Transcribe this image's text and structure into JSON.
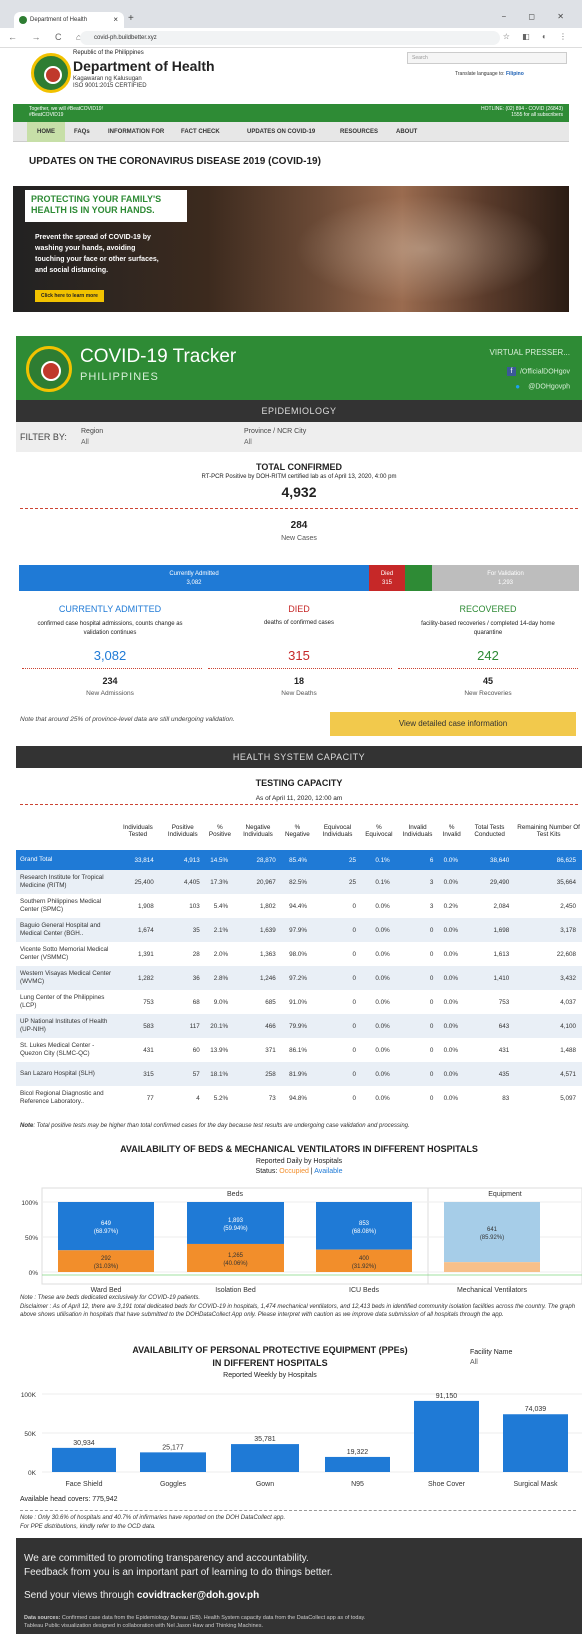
{
  "browser": {
    "tab_title": "Department of Health",
    "url": "covid-ph.buildbetter.xyz",
    "new_tab": "+",
    "controls": "−  ◻  ✕",
    "nav": "← → C ⌂",
    "icons": "☆ ◧ ◐ ⋮"
  },
  "doh": {
    "republic": "Republic of the Philippines",
    "department": "Department of Health",
    "kagawaran": "Kagawaran ng Kalusugan",
    "iso": "ISO 9001:2015 CERTIFIED",
    "search_placeholder": "Search",
    "translate_label": "Translate language to:",
    "translate_lang": "Filipino",
    "greenbar_left": [
      "Together, we will #BeatCOVID19!",
      "#BeatCOVID19"
    ],
    "greenbar_right": [
      "HOTLINE: (02) 894 - COVID (26843)",
      "1555 for all subscribers"
    ],
    "menu": [
      "HOME",
      "FAQs",
      "INFORMATION FOR",
      "FACT CHECK",
      "UPDATES ON COVID-19",
      "RESOURCES",
      "ABOUT"
    ],
    "page_title": "UPDATES ON THE CORONAVIRUS DISEASE 2019 (COVID-19)",
    "hero_headline": "PROTECTING YOUR FAMILY'S HEALTH IS IN YOUR HANDS.",
    "hero_desc": "Prevent the spread of COVID-19 by washing your hands, avoiding touching your face or other surfaces, and social distancing.",
    "hero_button": "Click here to learn more"
  },
  "tracker": {
    "title": "COVID-19 Tracker",
    "country": "PHILIPPINES",
    "virtual": "VIRTUAL PRESSER...",
    "facebook": "/OfficialDOHgov",
    "twitter": "@DOHgovph"
  },
  "epi": {
    "section": "EPIDEMIOLOGY",
    "filter_by": "FILTER BY:",
    "region_label": "Region",
    "region_value": "All",
    "province_label": "Province / NCR City",
    "province_value": "All",
    "total_title": "TOTAL CONFIRMED",
    "total_sub": "RT-PCR Positive by DOH-RITM certified lab as of April 13, 2020, 4:00 pm",
    "total": "4,932",
    "new_cases": "284",
    "new_cases_label": "New Cases",
    "bar": {
      "admitted_label": "Currently Admitted",
      "admitted": "3,082",
      "died_label": "Died",
      "died": "315",
      "validation_label": "For Validation",
      "validation": "1,293"
    },
    "admitted_title": "CURRENTLY ADMITTED",
    "admitted_desc": "confirmed case hospital admissions, counts change as validation continues",
    "admitted_value": "3,082",
    "new_admissions": "234",
    "new_admissions_label": "New Admissions",
    "died_title": "DIED",
    "died_desc": "deaths of confirmed cases",
    "died_value": "315",
    "new_deaths": "18",
    "new_deaths_label": "New Deaths",
    "recovered_title": "RECOVERED",
    "recovered_desc": "facility-based recoveries / completed 14-day home quarantine",
    "recovered_value": "242",
    "new_recoveries": "45",
    "new_recoveries_label": "New Recoveries",
    "note": "Note that around 25% of province-level data are still undergoing validation.",
    "detail_button": "View detailed case information"
  },
  "hsc": {
    "section": "HEALTH SYSTEM CAPACITY",
    "testing_title": "TESTING CAPACITY",
    "testing_sub": "As of April 11, 2020, 12:00 am",
    "headers": [
      "",
      "Individuals Tested",
      "Positive Individuals",
      "% Positive",
      "Negative Individuals",
      "% Negative",
      "Equivocal Individuals",
      "% Equivocal",
      "Invalid Individuals",
      "% Invalid",
      "Total Tests Conducted",
      "Remaining Number Of Test Kits"
    ],
    "rows": [
      [
        "Grand Total",
        "33,814",
        "4,913",
        "14.5%",
        "28,870",
        "85.4%",
        "25",
        "0.1%",
        "6",
        "0.0%",
        "38,640",
        "86,625"
      ],
      [
        "Research Institute for Tropical Medicine (RITM)",
        "25,400",
        "4,405",
        "17.3%",
        "20,967",
        "82.5%",
        "25",
        "0.1%",
        "3",
        "0.0%",
        "29,490",
        "35,664"
      ],
      [
        "Southern Philippines Medical Center (SPMC)",
        "1,908",
        "103",
        "5.4%",
        "1,802",
        "94.4%",
        "0",
        "0.0%",
        "3",
        "0.2%",
        "2,084",
        "2,450"
      ],
      [
        "Baguio General Hospital and Medical Center (BGH..",
        "1,674",
        "35",
        "2.1%",
        "1,639",
        "97.9%",
        "0",
        "0.0%",
        "0",
        "0.0%",
        "1,698",
        "3,178"
      ],
      [
        "Vicente Sotto Memorial Medical Center (VSMMC)",
        "1,391",
        "28",
        "2.0%",
        "1,363",
        "98.0%",
        "0",
        "0.0%",
        "0",
        "0.0%",
        "1,613",
        "22,608"
      ],
      [
        "Western Visayas Medical Center (WVMC)",
        "1,282",
        "36",
        "2.8%",
        "1,246",
        "97.2%",
        "0",
        "0.0%",
        "0",
        "0.0%",
        "1,410",
        "3,432"
      ],
      [
        "Lung Center of the Philippines (LCP)",
        "753",
        "68",
        "9.0%",
        "685",
        "91.0%",
        "0",
        "0.0%",
        "0",
        "0.0%",
        "753",
        "4,037"
      ],
      [
        "UP National Institutes of Health (UP-NIH)",
        "583",
        "117",
        "20.1%",
        "466",
        "79.9%",
        "0",
        "0.0%",
        "0",
        "0.0%",
        "643",
        "4,100"
      ],
      [
        "St. Lukes Medical Center - Quezon City (SLMC-QC)",
        "431",
        "60",
        "13.9%",
        "371",
        "86.1%",
        "0",
        "0.0%",
        "0",
        "0.0%",
        "431",
        "1,488"
      ],
      [
        "San Lazaro Hospital (SLH)",
        "315",
        "57",
        "18.1%",
        "258",
        "81.9%",
        "0",
        "0.0%",
        "0",
        "0.0%",
        "435",
        "4,571"
      ],
      [
        "Bicol Regional Diagnostic and Reference Laboratory..",
        "77",
        "4",
        "5.2%",
        "73",
        "94.8%",
        "0",
        "0.0%",
        "0",
        "0.0%",
        "83",
        "5,097"
      ]
    ],
    "table_note_bold": "Note",
    "table_note": ": Total positive tests may be higher than total confirmed cases for the day because test results are undergoing case validation and processing.",
    "beds_title": "AVAILABILITY OF BEDS & MECHANICAL VENTILATORS IN DIFFERENT HOSPITALS",
    "beds_sub": "Reported Daily by Hospitals",
    "status_label": "Status:",
    "status_occupied": "Occupied",
    "status_sep": " | ",
    "status_available": "Available",
    "beds_note": "Note : These are beds dedicated exclusively for COVID-19 patients.",
    "beds_disclaimer": "Disclaimer : As of April 12, there are 3,191 total dedicated beds for COVID-19 in hospitals, 1,474 mechanical ventilators, and 12,413 beds in identified community isolation facilities across the country. The graph above shows utilisation in hospitals that have submitted to the DOHDataCollect App only. Please interpret with caution as we improve data submission of all hospitals through the app.",
    "ppe_title1": "AVAILABILITY OF PERSONAL PROTECTIVE EQUIPMENT (PPEs)",
    "ppe_title2": "IN DIFFERENT HOSPITALS",
    "ppe_sub": "Reported Weekly by Hospitals",
    "facility_label": "Facility Name",
    "facility_value": "All",
    "head_covers": "Available head covers: 775,942",
    "ppe_note1": "Note : Only 30.6% of hospitals and 40.7% of infirmaries have reported on the DOH DataCollect app.",
    "ppe_note2": "For PPE distributions, kindly refer to the OCD data."
  },
  "chart_data": [
    {
      "type": "bar",
      "title": "AVAILABILITY OF BEDS & MECHANICAL VENTILATORS IN DIFFERENT HOSPITALS",
      "panels": [
        "Beds",
        "Equipment"
      ],
      "categories": [
        "Ward Bed",
        "Isolation Bed",
        "ICU Beds",
        "Mechanical Ventilators"
      ],
      "y_ticks": [
        "100%",
        "50%",
        "0%"
      ],
      "series": [
        {
          "name": "Available",
          "values": [
            649,
            1893,
            853,
            641
          ],
          "labels": [
            "649",
            "1,893",
            "853",
            "641"
          ],
          "pct": [
            "(68.97%)",
            "(59.94%)",
            "(68.08%)",
            "(85.92%)"
          ]
        },
        {
          "name": "Occupied",
          "values": [
            292,
            1265,
            400,
            105
          ],
          "labels": [
            "292",
            "1,265",
            "400",
            ""
          ],
          "pct": [
            "(31.03%)",
            "(40.06%)",
            "(31.92%)",
            ""
          ]
        }
      ],
      "colors": {
        "available": "#1f7ad6",
        "occupied": "#f28e2b",
        "equipment_available": "#a6cde8",
        "equipment_occupied": "#f7c08a"
      }
    },
    {
      "type": "bar",
      "title": "AVAILABILITY OF PERSONAL PROTECTIVE EQUIPMENT (PPEs) IN DIFFERENT HOSPITALS",
      "categories": [
        "Face Shield",
        "Goggles",
        "Gown",
        "N95",
        "Shoe Cover",
        "Surgical Mask"
      ],
      "values": [
        30934,
        25177,
        35781,
        19322,
        91150,
        74039
      ],
      "labels": [
        "30,934",
        "25,177",
        "35,781",
        "19,322",
        "91,150",
        "74,039"
      ],
      "y_ticks": [
        "100K",
        "50K",
        "0K"
      ],
      "ylim": [
        0,
        100000
      ],
      "color": "#1f7ad6"
    }
  ],
  "footer": {
    "line1": "We are committed to promoting transparency and accountability.",
    "line2": "Feedback from you is an important part of learning to do things better.",
    "send": "Send your views through ",
    "email": "covidtracker@doh.gov.ph",
    "sources_bold": "Data sources:",
    "sources": " Confirmed case data from the Epidemiology Bureau (EB). Health System capacity data from the DataCollect app as of today.",
    "credits": "Tableau Public visualization designed in collaboration with Nel Jason Haw and Thinking Machines."
  },
  "colors": {
    "green": "#2e8b35",
    "blue": "#1f7ad6",
    "red": "#c62828",
    "gray": "#bdbdbd",
    "yellow": "#f2c94c"
  }
}
